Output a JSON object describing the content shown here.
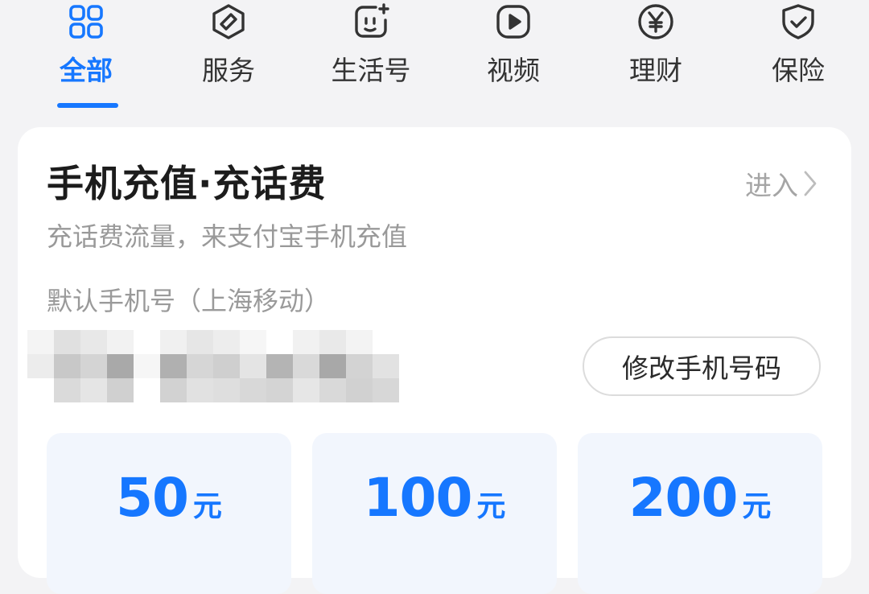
{
  "tabs": [
    {
      "label": "全部",
      "icon": "grid-icon",
      "active": true
    },
    {
      "label": "服务",
      "icon": "service-icon",
      "active": false
    },
    {
      "label": "生活号",
      "icon": "lifestyle-account-icon",
      "active": false
    },
    {
      "label": "视频",
      "icon": "video-play-icon",
      "active": false
    },
    {
      "label": "理财",
      "icon": "yuan-coin-icon",
      "active": false
    },
    {
      "label": "保险",
      "icon": "shield-check-icon",
      "active": false
    }
  ],
  "card": {
    "title": "手机充值·充话费",
    "enter_label": "进入",
    "subtitle": "充话费流量，来支付宝手机充值",
    "default_phone_label": "默认手机号（上海移动）",
    "modify_button_label": "修改手机号码",
    "amounts": [
      {
        "value": "50",
        "unit": "元"
      },
      {
        "value": "100",
        "unit": "元"
      },
      {
        "value": "200",
        "unit": "元"
      }
    ]
  },
  "colors": {
    "accent": "#1677ff",
    "background": "#f3f3f5",
    "card": "#ffffff",
    "amount_tile": "#f2f6fd"
  }
}
